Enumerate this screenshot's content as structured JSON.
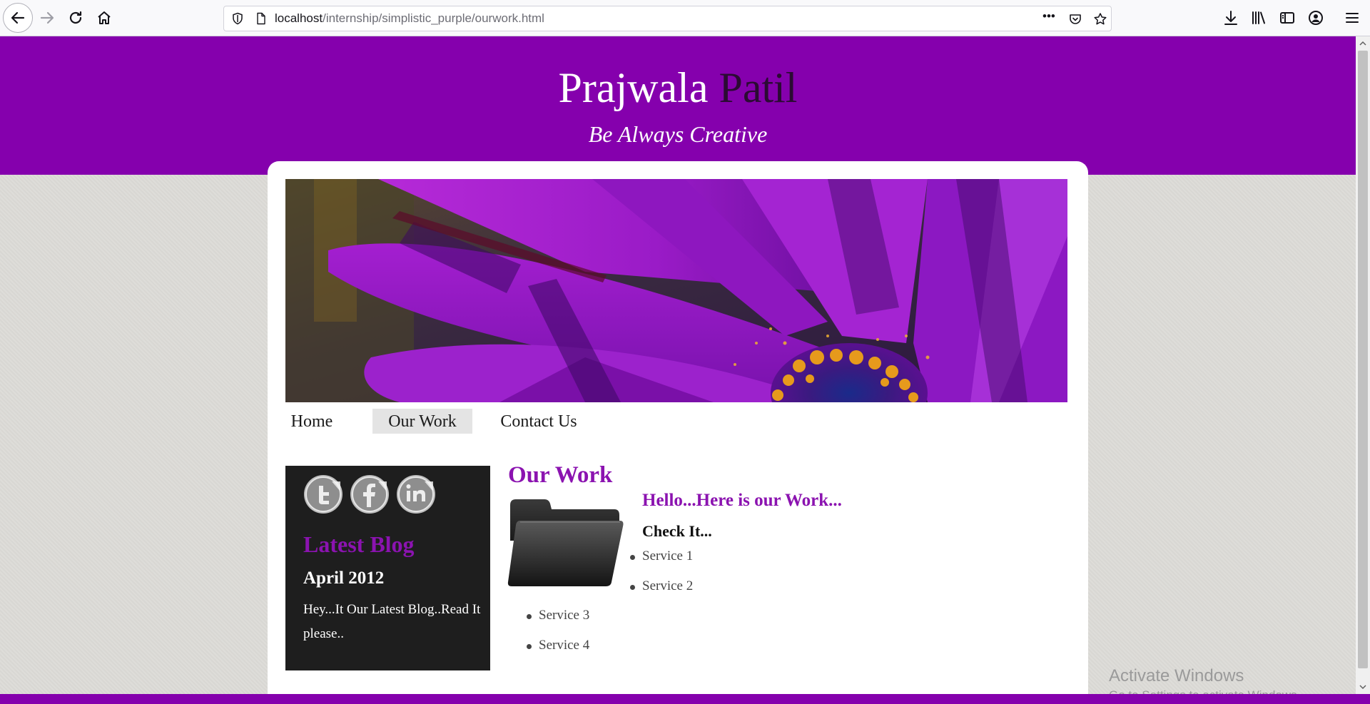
{
  "browser": {
    "url_host": "localhost",
    "url_path": "/internship/simplistic_purple/ourwork.html",
    "more_label": "•••"
  },
  "site": {
    "title_first": "Prajwala",
    "title_last": "Patil",
    "tagline": "Be Always Creative"
  },
  "nav": {
    "items": [
      {
        "label": "Home"
      },
      {
        "label": "Our Work"
      },
      {
        "label": "Contact Us"
      }
    ],
    "active_index": 1
  },
  "sidebar": {
    "social_icons": [
      "twitter-icon",
      "facebook-icon",
      "linkedin-icon"
    ],
    "blog_title": "Latest Blog",
    "blog_date": "April 2012",
    "blog_text": "Hey...It Our Latest Blog..Read It please.."
  },
  "main": {
    "title": "Our Work",
    "subtitle": "Hello...Here is our Work...",
    "check_title": "Check It...",
    "services": [
      "Service 1",
      "Service 2",
      "Service 3",
      "Service 4"
    ]
  },
  "watermark": {
    "line1": "Activate Windows",
    "line2": "Go to Settings to activate Windows."
  },
  "colors": {
    "brand_purple": "#8500ad",
    "heading_purple": "#8b13b0",
    "sidebar_bg": "#1e1e1e",
    "page_bg": "#dcdbd7"
  }
}
